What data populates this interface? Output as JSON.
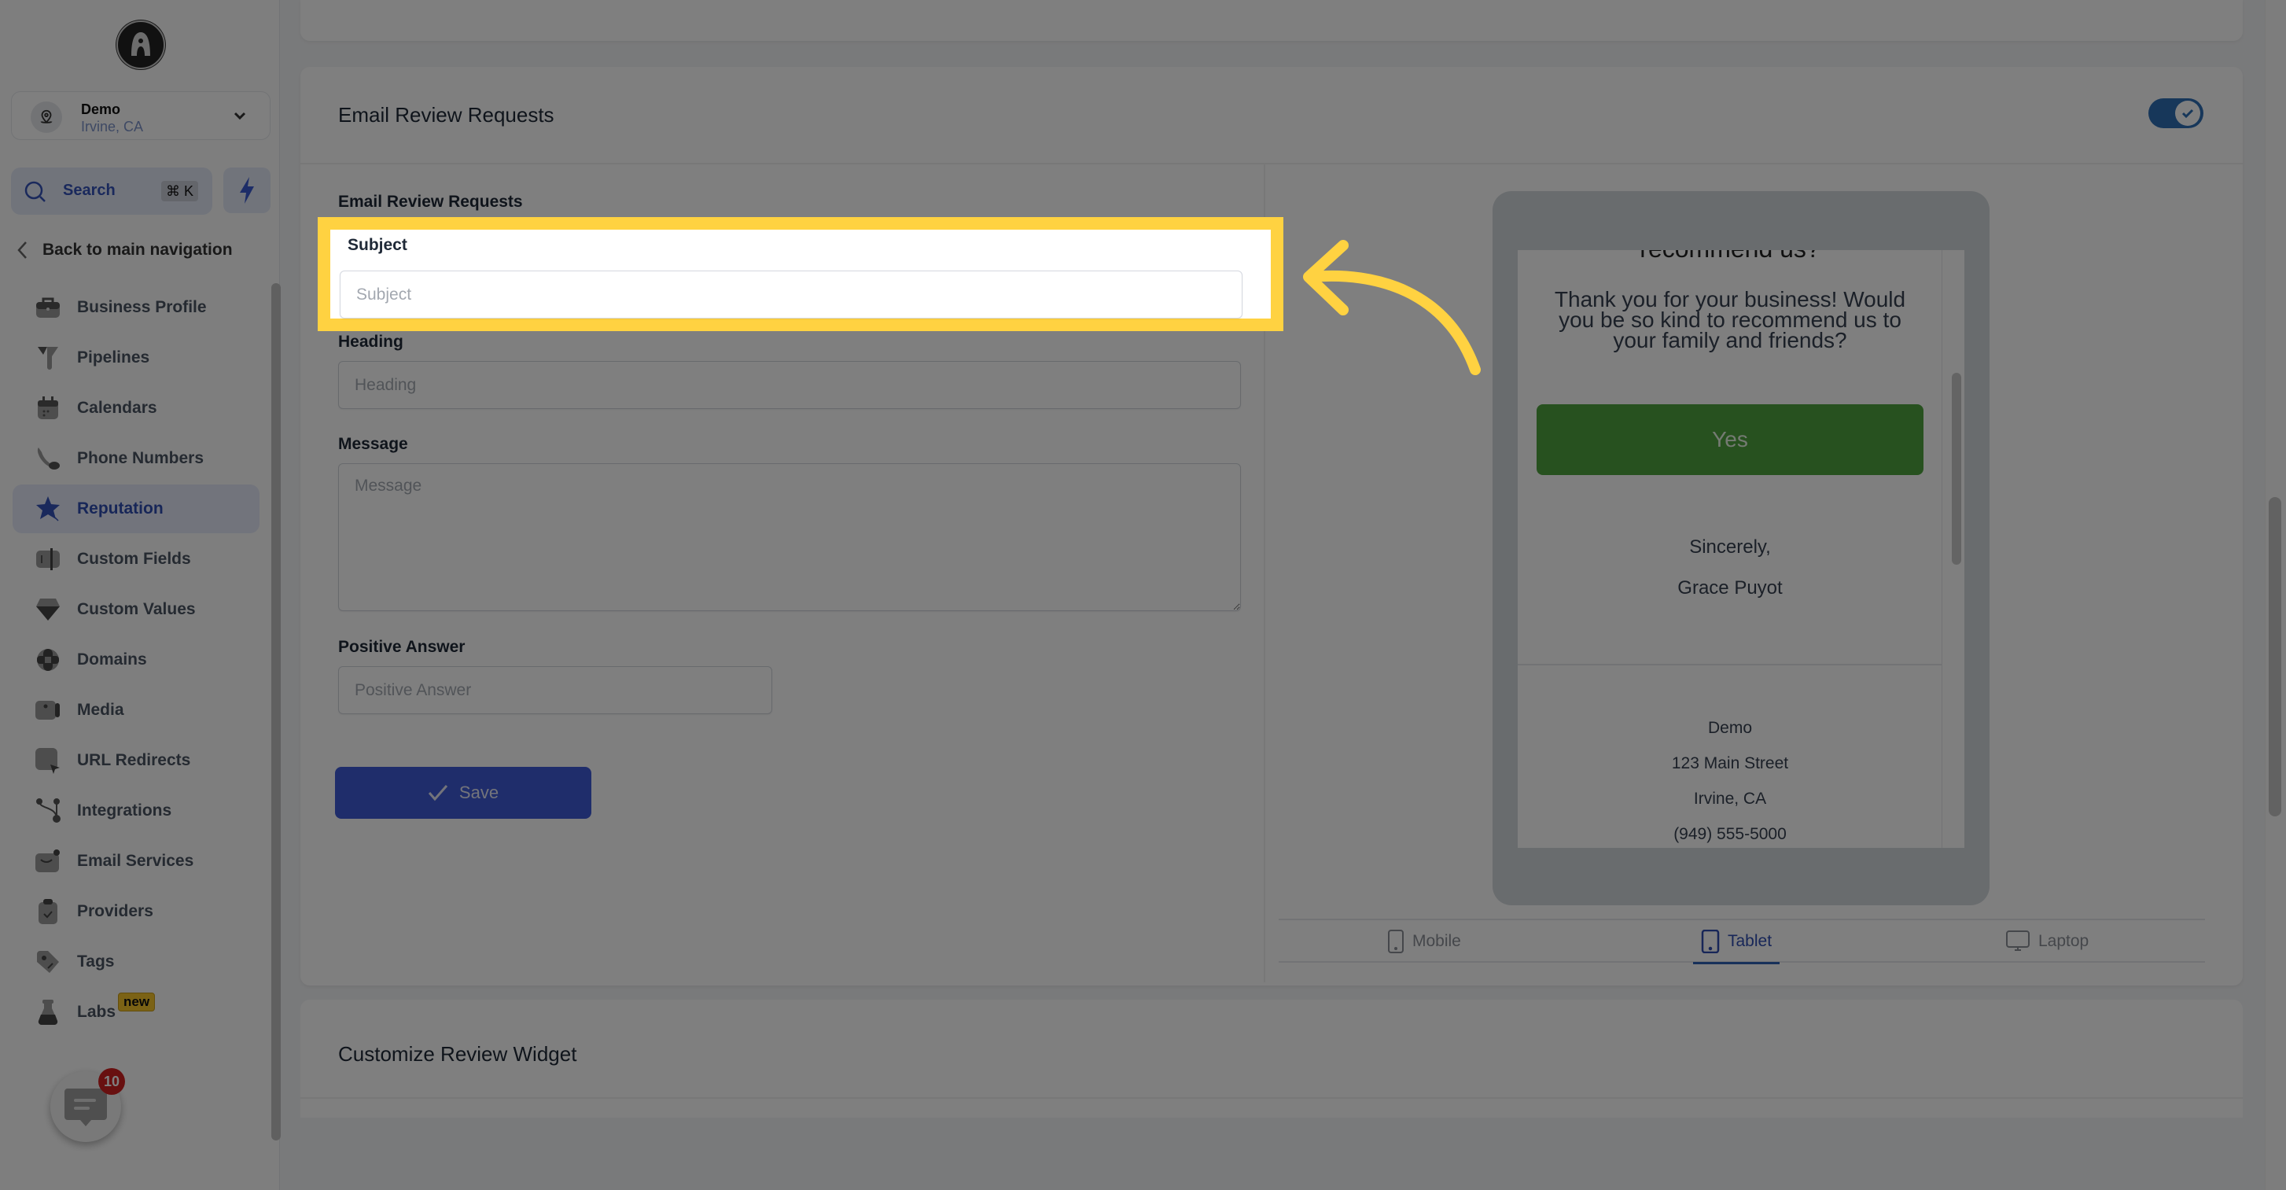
{
  "sidebar": {
    "account": {
      "name": "Demo",
      "location": "Irvine, CA"
    },
    "search": {
      "label": "Search",
      "shortcut": "⌘ K"
    },
    "back_label": "Back to main navigation",
    "items": [
      {
        "label": "Business Profile",
        "icon": "briefcase-icon",
        "active": false
      },
      {
        "label": "Pipelines",
        "icon": "funnel-icon",
        "active": false
      },
      {
        "label": "Calendars",
        "icon": "calendar-icon",
        "active": false
      },
      {
        "label": "Phone Numbers",
        "icon": "phone-icon",
        "active": false
      },
      {
        "label": "Reputation",
        "icon": "star-icon",
        "active": true
      },
      {
        "label": "Custom Fields",
        "icon": "custom-fields-icon",
        "active": false
      },
      {
        "label": "Custom Values",
        "icon": "diamond-icon",
        "active": false
      },
      {
        "label": "Domains",
        "icon": "globe-icon",
        "active": false
      },
      {
        "label": "Media",
        "icon": "video-icon",
        "active": false
      },
      {
        "label": "URL Redirects",
        "icon": "cursor-icon",
        "active": false
      },
      {
        "label": "Integrations",
        "icon": "branch-icon",
        "active": false
      },
      {
        "label": "Email Services",
        "icon": "mail-icon",
        "active": false
      },
      {
        "label": "Providers",
        "icon": "clipboard-check-icon",
        "active": false
      },
      {
        "label": "Tags",
        "icon": "tag-icon",
        "active": false
      },
      {
        "label": "Labs",
        "icon": "flask-icon",
        "active": false,
        "badge": "new"
      }
    ],
    "chat_badge_count": "10"
  },
  "email_review": {
    "title": "Email Review Requests",
    "enabled": true,
    "section_label": "Email Review Requests",
    "fields": {
      "subject": {
        "label": "Subject",
        "value": "",
        "placeholder": "Subject"
      },
      "heading": {
        "label": "Heading",
        "value": "",
        "placeholder": "Heading"
      },
      "message": {
        "label": "Message",
        "value": "",
        "placeholder": "Message"
      },
      "positive_answer": {
        "label": "Positive Answer",
        "value": "",
        "placeholder": "Positive Answer"
      }
    },
    "save_label": "Save",
    "preview": {
      "cut_heading": "recommend us?",
      "message": "Thank you for your business! Would you be so kind to recommend us to your family and friends?",
      "yes_label": "Yes",
      "signoff": "Sincerely,",
      "signer": "Grace Puyot",
      "business_name": "Demo",
      "street": "123 Main Street",
      "city": "Irvine, CA",
      "phone": "(949) 555-5000"
    },
    "device_tabs": [
      {
        "label": "Mobile",
        "active": false
      },
      {
        "label": "Tablet",
        "active": true
      },
      {
        "label": "Laptop",
        "active": false
      }
    ]
  },
  "widget_section": {
    "title": "Customize Review Widget"
  },
  "colors": {
    "highlight": "#ffd241",
    "accent": "#3e5bd6",
    "yes_button": "#4fa33f",
    "badge_red": "#d12020"
  }
}
